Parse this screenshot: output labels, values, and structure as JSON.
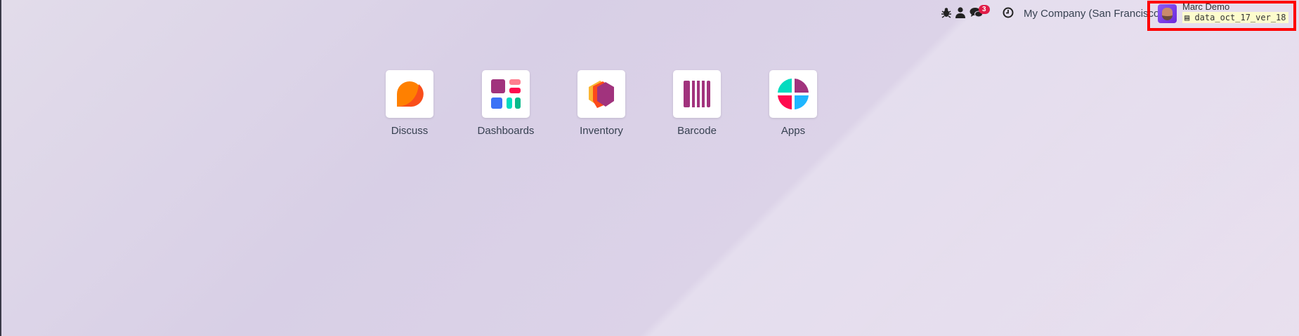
{
  "topbar": {
    "icons": [
      "bug-icon",
      "user-icon",
      "chat-icon",
      "clock-icon"
    ],
    "messages_badge": "3",
    "company": "My Company (San Francisco)",
    "user_name": "Marc Demo",
    "database": "data_oct_17_ver_18"
  },
  "apps": [
    {
      "label": "Discuss",
      "icon": "discuss-icon"
    },
    {
      "label": "Dashboards",
      "icon": "dashboards-icon"
    },
    {
      "label": "Inventory",
      "icon": "inventory-icon"
    },
    {
      "label": "Barcode",
      "icon": "barcode-icon"
    },
    {
      "label": "Apps",
      "icon": "apps-icon"
    }
  ],
  "colors": {
    "highlight_box": "#ff0000",
    "badge": "#e11d48",
    "background": "#d8cfe6"
  }
}
